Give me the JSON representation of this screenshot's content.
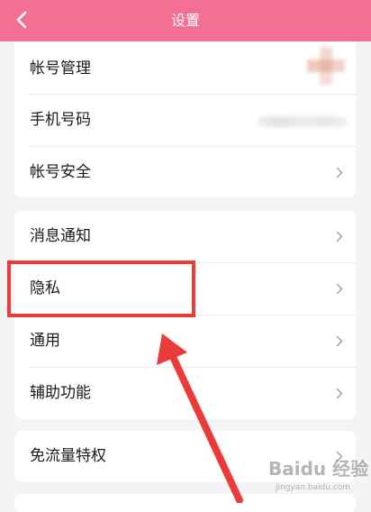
{
  "header": {
    "title": "设置",
    "back_icon": "chevron-left-icon",
    "background": "#f56e93"
  },
  "account_group": {
    "items": [
      {
        "label": "帐号管理",
        "value": "avatar (blurred)"
      },
      {
        "label": "手机号码",
        "value": "phone number (blurred)"
      },
      {
        "label": "帐号安全"
      }
    ]
  },
  "general_group": {
    "items": [
      {
        "label": "消息通知"
      },
      {
        "label": "隐私"
      },
      {
        "label": "通用"
      },
      {
        "label": "辅助功能"
      }
    ]
  },
  "extra_group": {
    "items": [
      {
        "label": "免流量特权"
      }
    ]
  },
  "annotation": {
    "highlight_color": "#ea3a3a"
  },
  "watermark": {
    "brand": "Baidu 经验",
    "sub": "jingyan.baidu.com"
  }
}
